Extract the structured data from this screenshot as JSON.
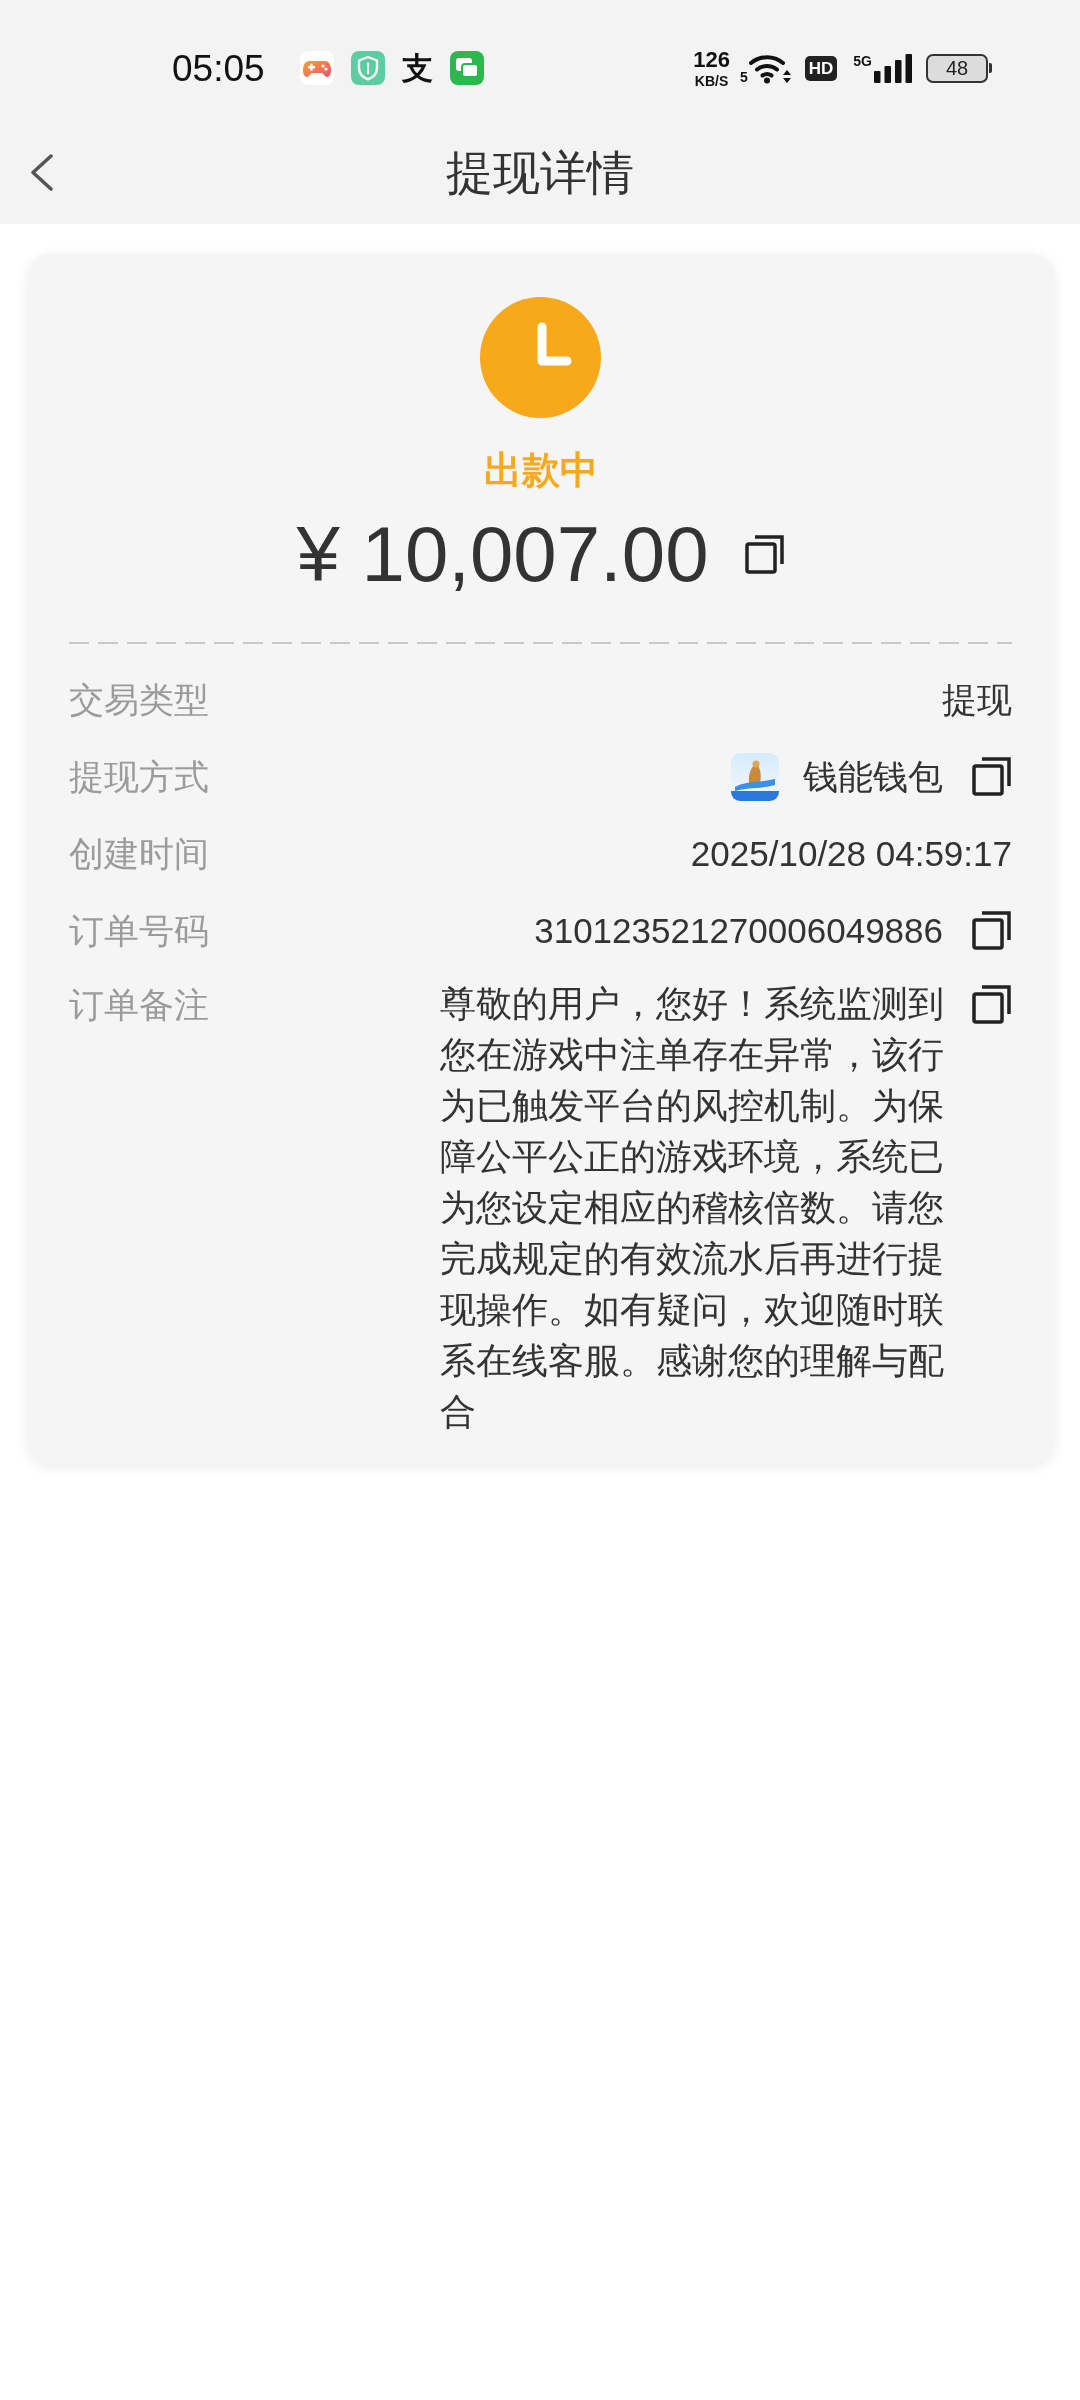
{
  "status_bar": {
    "time": "05:05",
    "notifications": [
      {
        "kind": "game"
      },
      {
        "kind": "shield"
      },
      {
        "kind": "glyph",
        "text": "支"
      },
      {
        "kind": "chat"
      }
    ],
    "net_speed": {
      "value": "126",
      "unit": "KB/S"
    },
    "wifi_label": "5",
    "hd_badge": "HD",
    "network_type": "5G",
    "battery": "48"
  },
  "header": {
    "title": "提现详情"
  },
  "summary": {
    "status": {
      "kind": "pending",
      "label": "出款中"
    },
    "amount": "¥ 10,007.00",
    "amount_copyable": true
  },
  "details": [
    {
      "kind": "text",
      "label": "交易类型",
      "value": "提现",
      "copyable": false
    },
    {
      "kind": "app",
      "label": "提现方式",
      "value": "钱能钱包",
      "copyable": true
    },
    {
      "kind": "text",
      "label": "创建时间",
      "value": "2025/10/28 04:59:17",
      "copyable": false
    },
    {
      "kind": "text",
      "label": "订单号码",
      "value": "310123521270006049886",
      "copyable": true
    },
    {
      "kind": "note",
      "label": "订单备注",
      "value": "尊敬的用户，您好！系统监测到您在游戏中注单存在异常，该行为已触发平台的风控机制。为保障公平公正的游戏环境，系统已为您设定相应的稽核倍数。请您完成规定的有效流水后再进行提现操作。如有疑问，欢迎随时联系在线客服。感谢您的理解与配合",
      "copyable": true
    }
  ]
}
